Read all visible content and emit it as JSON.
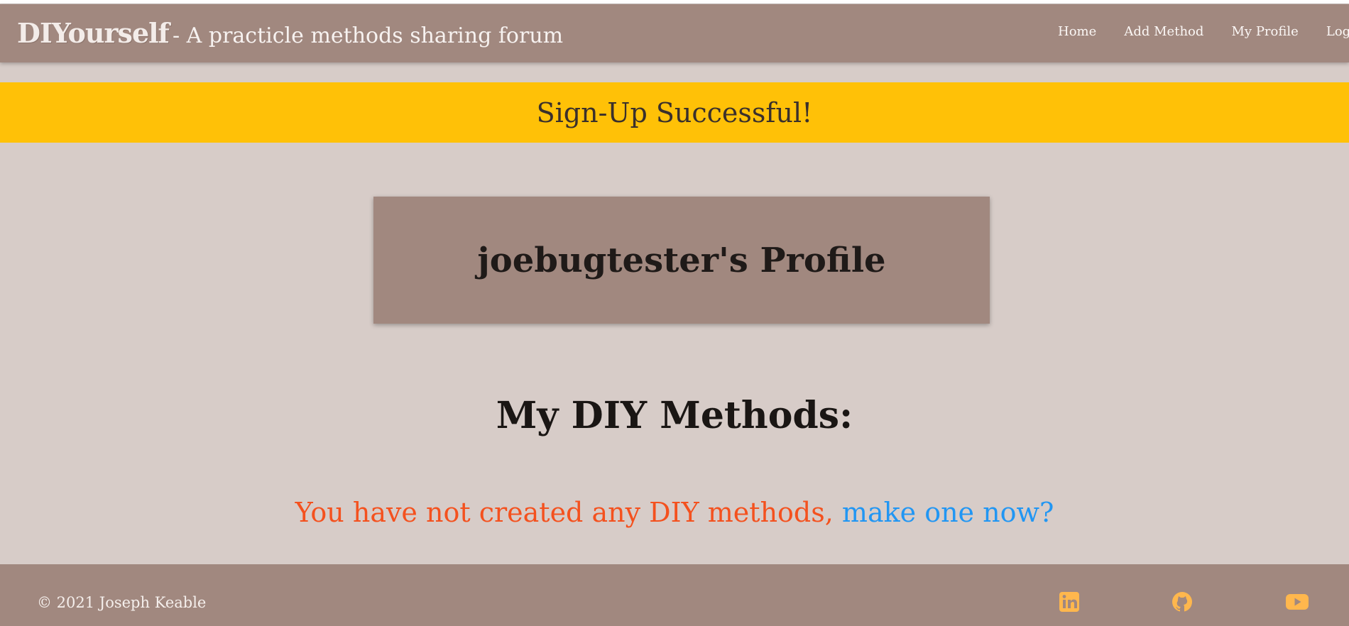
{
  "navbar": {
    "brand_name": "DIYourself",
    "brand_tagline": "- A practicle methods sharing forum",
    "links": [
      {
        "label": "Home"
      },
      {
        "label": "Add Method"
      },
      {
        "label": "My Profile"
      },
      {
        "label": "Log Out"
      }
    ]
  },
  "flash": {
    "message": "Sign-Up Successful!"
  },
  "profile": {
    "title": "joebugtester's Profile"
  },
  "methods": {
    "heading": "My DIY Methods:",
    "empty_text": "You have not created any DIY methods,",
    "create_link": "make one now?"
  },
  "footer": {
    "copyright": "© 2021 Joseph Keable",
    "social_icons": [
      "linkedin-icon",
      "github-icon",
      "youtube-icon"
    ]
  },
  "colors": {
    "primary": "#a1887f",
    "background": "#d7ccc8",
    "flash": "#ffc107",
    "empty_text": "#f4511e",
    "link": "#2196f3",
    "social_icon": "#ffb74d"
  }
}
